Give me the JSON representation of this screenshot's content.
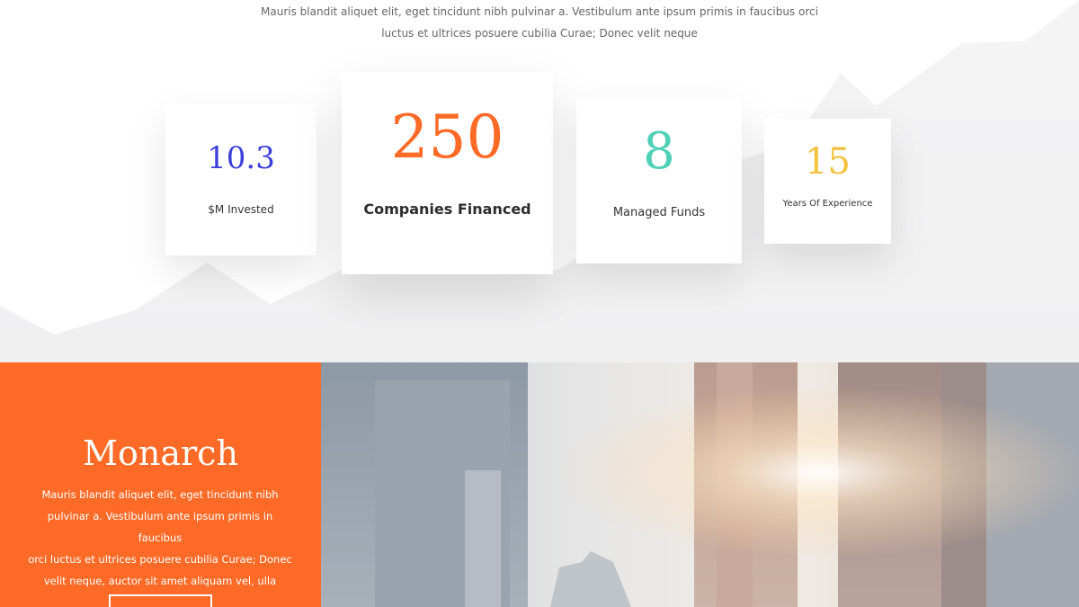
{
  "intro": {
    "line1": "Mauris blandit aliquet elit, eget tincidunt nibh pulvinar a. Vestibulum ante ipsum primis in faucibus orci",
    "line2": "luctus et ultrices posuere cubilia Curae; Donec velit neque"
  },
  "stats": [
    {
      "value": "10.3",
      "label": "$M Invested",
      "color": "#3b3fd8"
    },
    {
      "value": "250",
      "label": "Companies Financed",
      "color": "#ff6a26"
    },
    {
      "value": "8",
      "label": "Managed Funds",
      "color": "#4fd1b7"
    },
    {
      "value": "15",
      "label": "Years Of Experience",
      "color": "#f3c23c"
    }
  ],
  "monarch": {
    "title": "Monarch",
    "description_lines": [
      "Mauris blandit aliquet elit, eget tincidunt nibh",
      "pulvinar a. Vestibulum ante ipsum primis in faucibus",
      "orci luctus et ultrices posuere cubilia Curae; Donec",
      "velit neque, auctor sit amet aliquam vel, ulla"
    ],
    "accent_color": "#ff6a26"
  }
}
